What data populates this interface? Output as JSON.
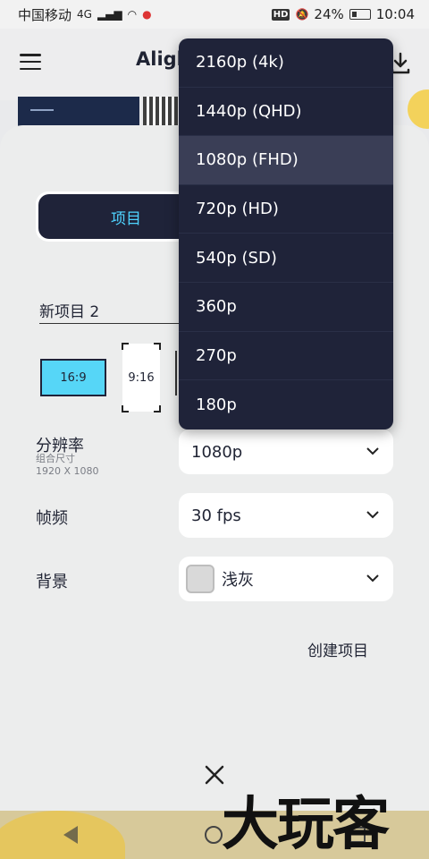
{
  "status_bar": {
    "carrier": "中国移动",
    "network": "4G",
    "hd": "HD",
    "battery": "24%",
    "time": "10:04"
  },
  "app": {
    "title": "Aligh"
  },
  "tabs": {
    "active_label": "项目"
  },
  "project": {
    "name": "新项目 2",
    "ratios": [
      "16:9",
      "9:16"
    ]
  },
  "resolution": {
    "label": "分辨率",
    "sub_label": "组合尺寸",
    "dimensions": "1920 X 1080",
    "value": "1080p",
    "options": [
      "2160p (4k)",
      "1440p (QHD)",
      "1080p (FHD)",
      "720p (HD)",
      "540p (SD)",
      "360p",
      "270p",
      "180p"
    ],
    "selected_index": 2
  },
  "frame_rate": {
    "label": "帧频",
    "value": "30 fps"
  },
  "background": {
    "label": "背景",
    "value": "浅灰",
    "swatch_color": "#d9d9d9"
  },
  "actions": {
    "create": "创建项目"
  },
  "watermark": "大玩客",
  "colors": {
    "dark": "#1f2339",
    "accent": "#4fd3ff",
    "ratio_selected": "#56d6f7"
  }
}
